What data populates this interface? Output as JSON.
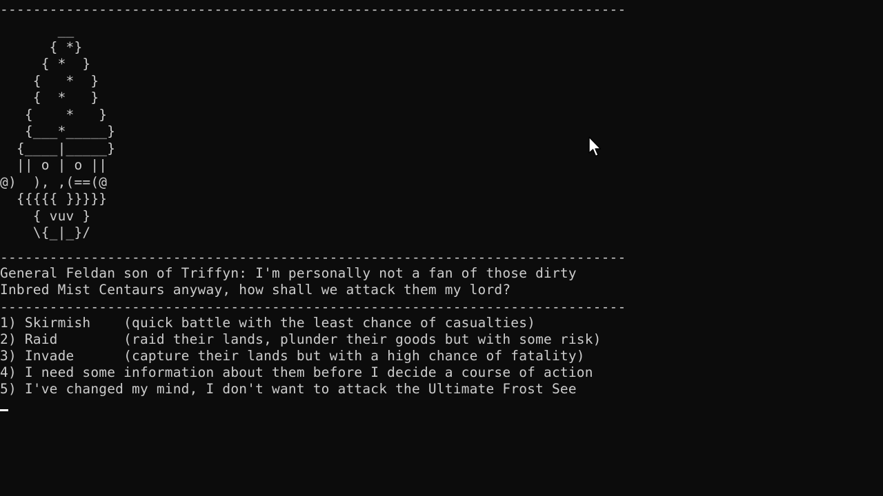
{
  "terminal": {
    "divider": "----------------------------------------------------------------------------",
    "art": [
      "       __",
      "      { *}",
      "     { *  }",
      "    {   *  }",
      "    {  *   }",
      "   {    *   }",
      "   {___*_____}",
      "  {____|_____}",
      "  || o | o ||",
      "@)  ), ,(==(@",
      "  {{{{{ }}}}}",
      "    { vuv }",
      "    \\{_|_}/"
    ],
    "dialogue": [
      "General Feldan son of Triffyn: I'm personally not a fan of those dirty",
      "Inbred Mist Centaurs anyway, how shall we attack them my lord?"
    ],
    "options": [
      "1) Skirmish    (quick battle with the least chance of casualties)",
      "2) Raid        (raid their lands, plunder their goods but with some risk)",
      "3) Invade      (capture their lands but with a high chance of fatality)",
      "4) I need some information about them before I decide a course of action",
      "5) I've changed my mind, I don't want to attack the Ultimate Frost See"
    ],
    "prompt_input": "",
    "cursor_icon": "mouse-pointer-icon"
  }
}
